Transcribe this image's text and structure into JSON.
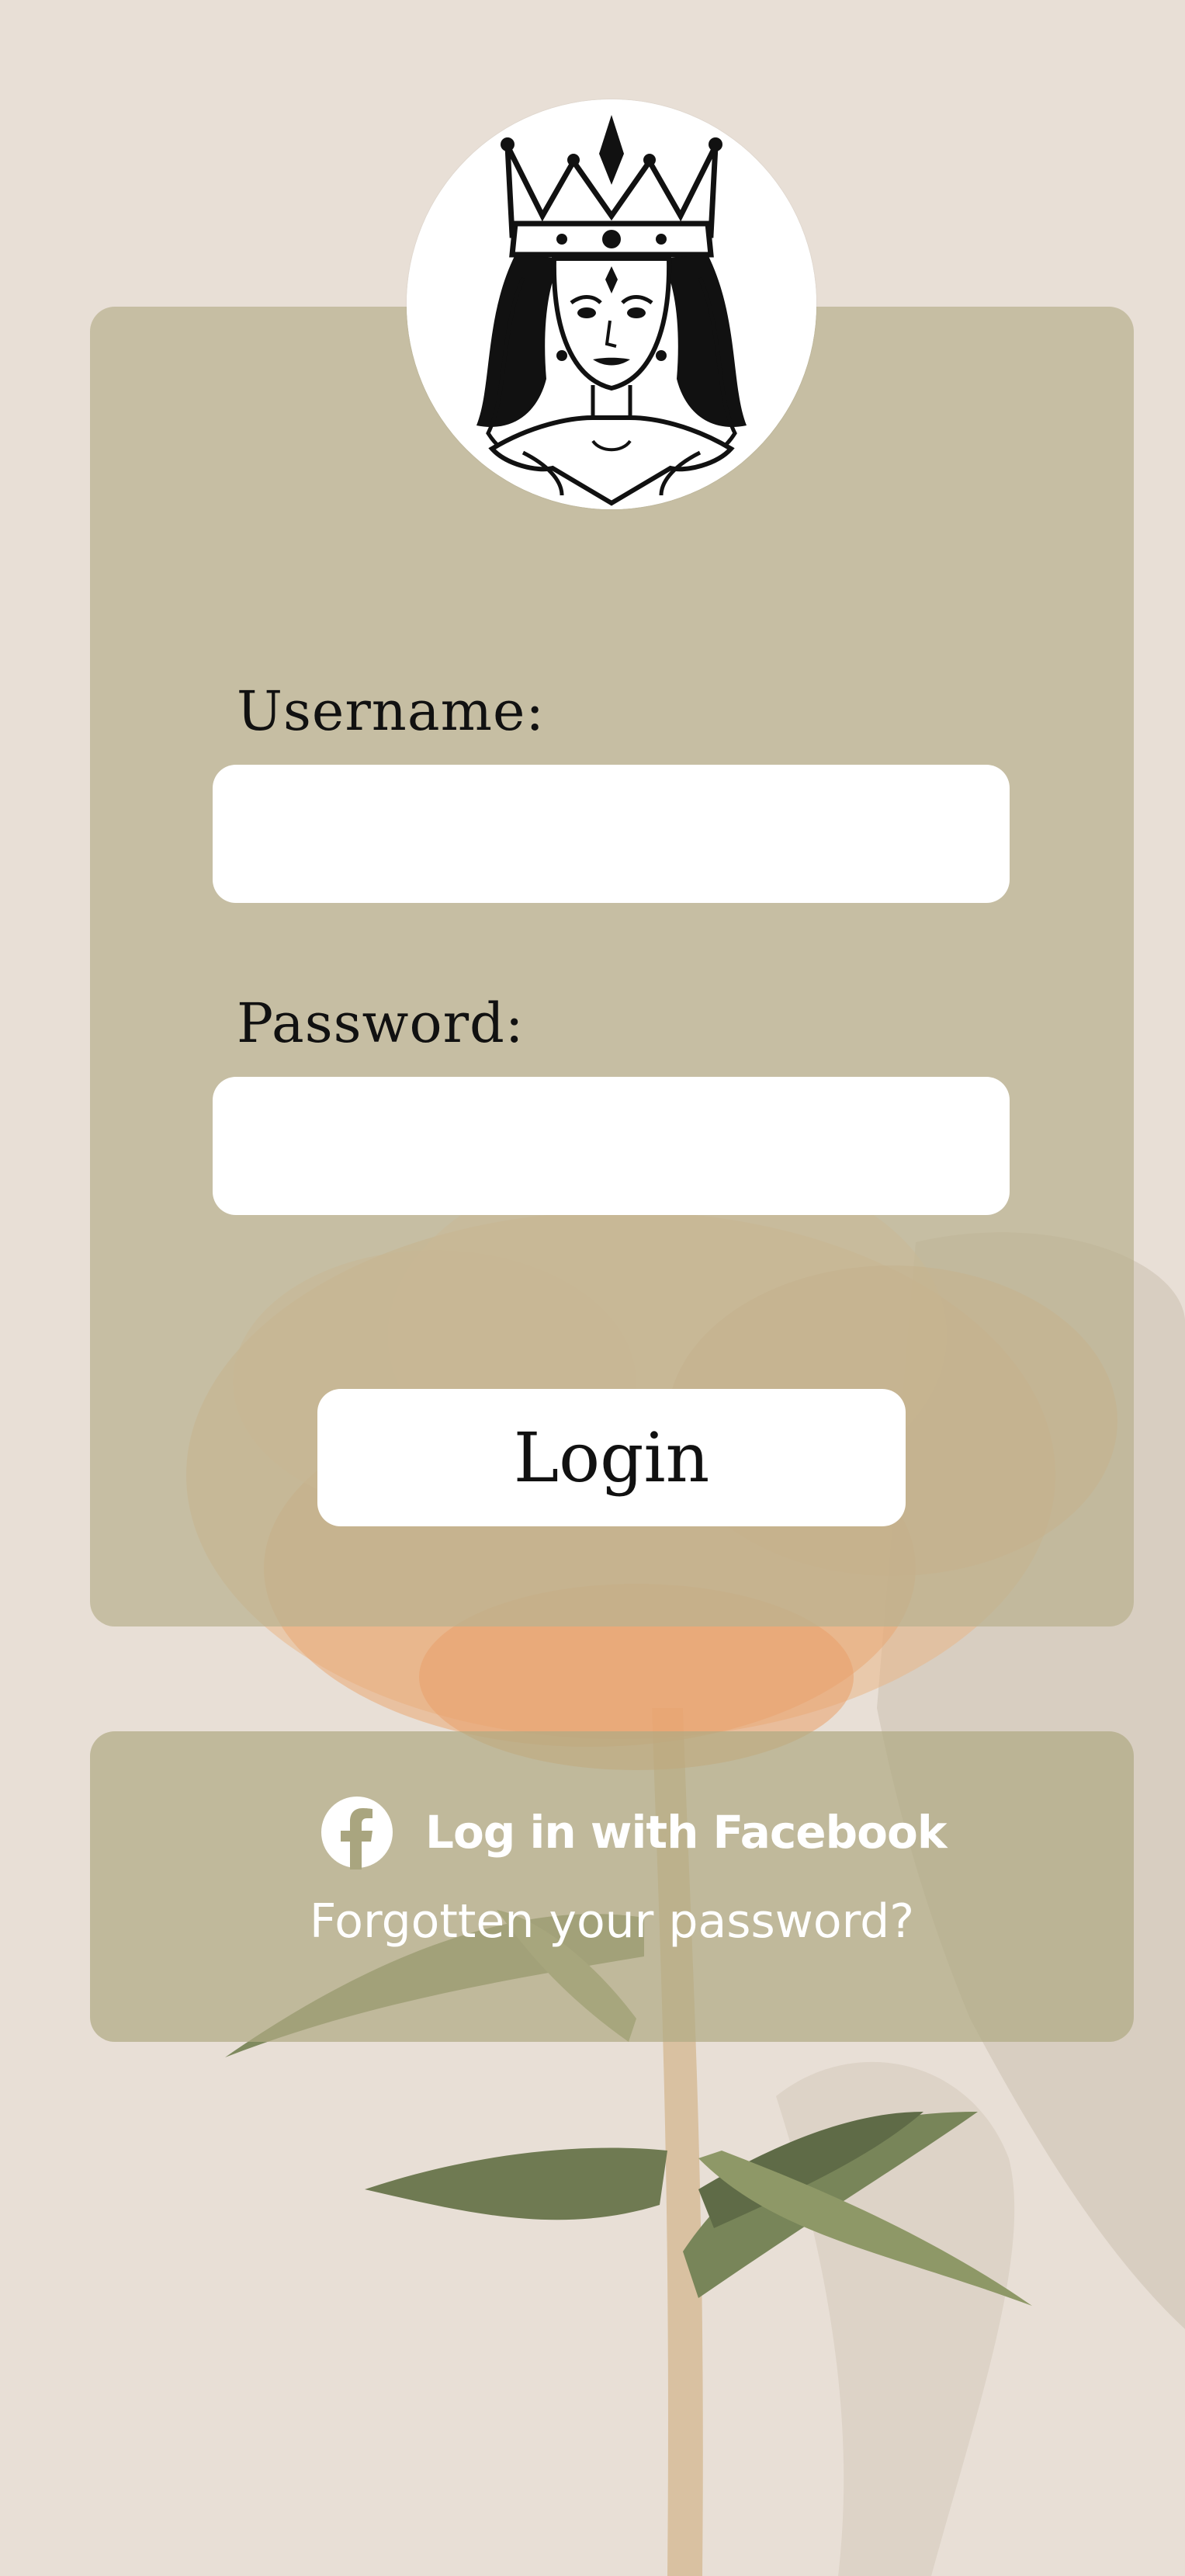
{
  "colors": {
    "background": "#e9e0d8",
    "card": "#bab291",
    "card_secondary": "#b0aa84",
    "input_background": "#ffffff",
    "label_text": "#111111",
    "link_text": "#ffffff"
  },
  "logo": {
    "icon": "queen-with-crown-illustration"
  },
  "login_form": {
    "username_label": "Username:",
    "username_value": "",
    "password_label": "Password:",
    "password_value": "",
    "login_button": "Login"
  },
  "social": {
    "facebook_icon": "facebook-icon",
    "facebook_label": "Log in with Facebook",
    "forgot_password": "Forgotten your password?"
  }
}
